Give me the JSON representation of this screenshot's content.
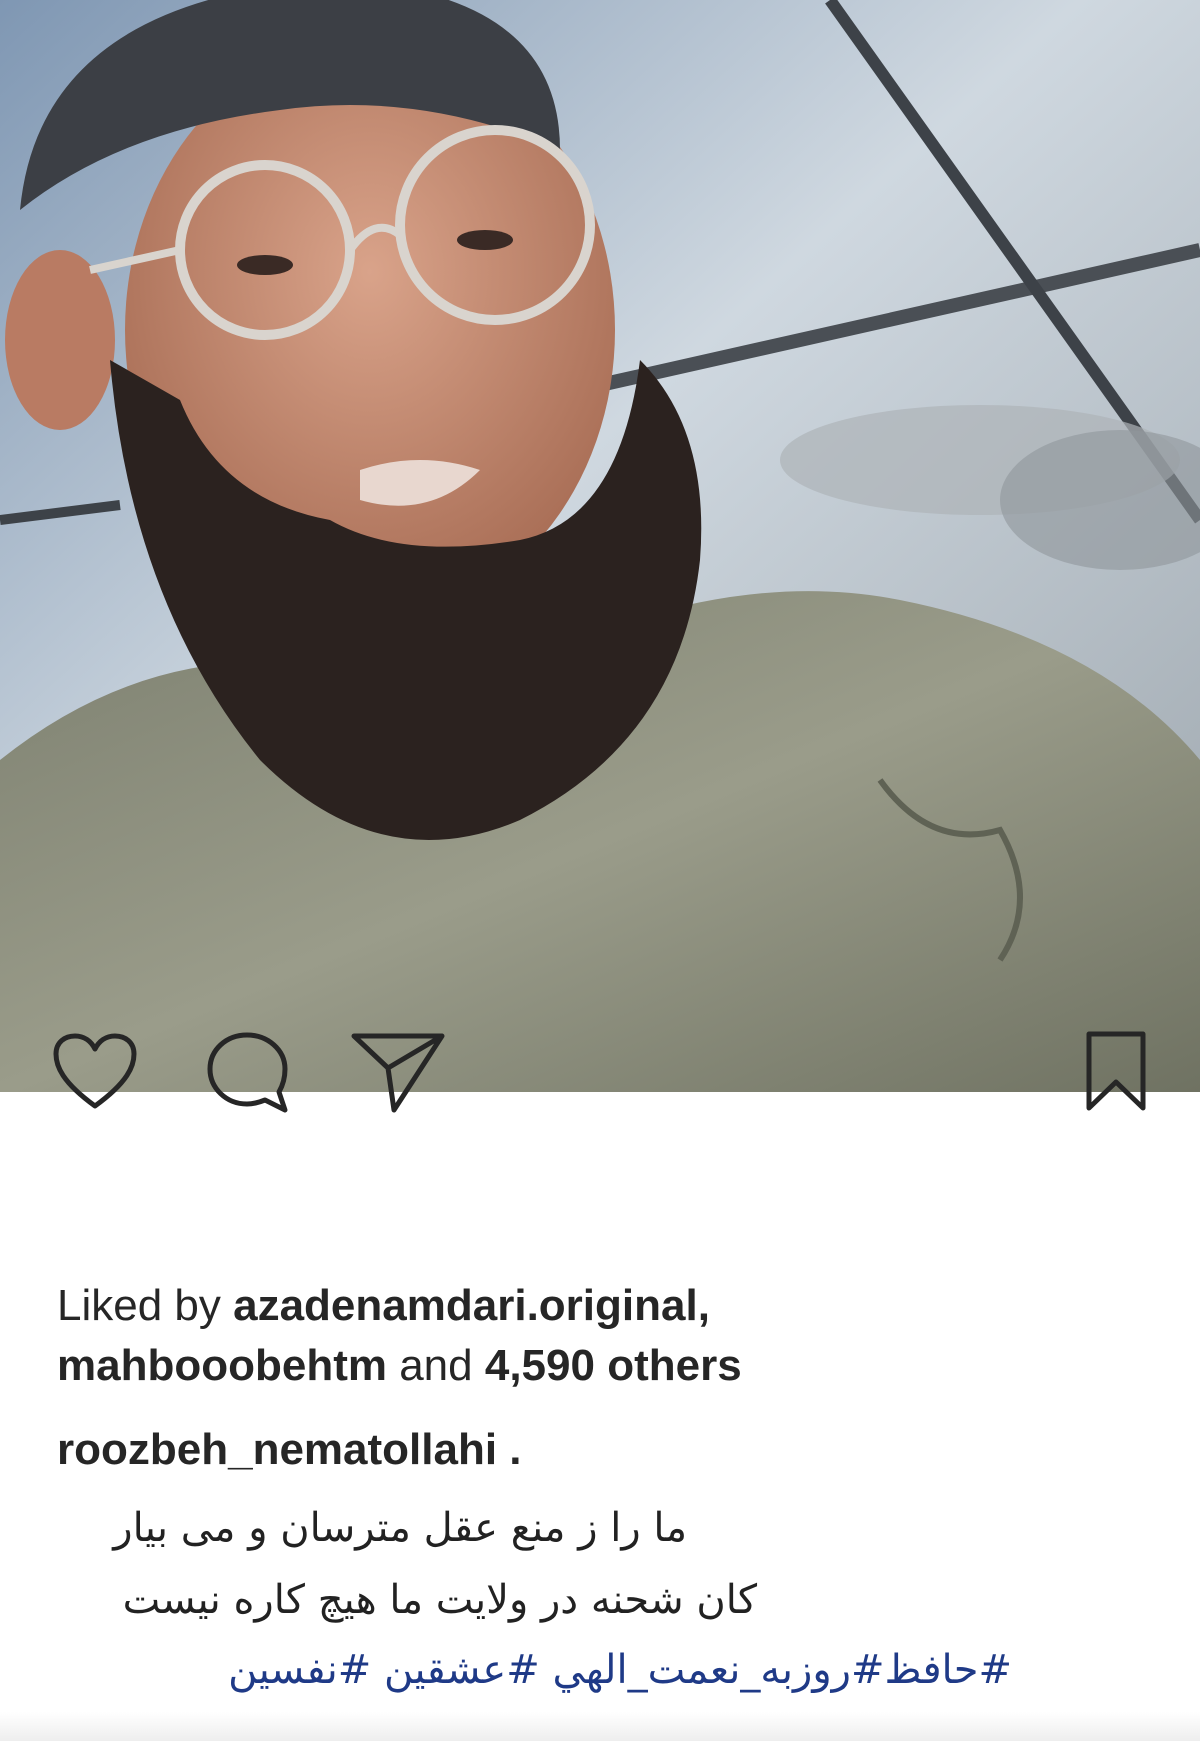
{
  "post": {
    "image_alt": "selfie photo",
    "actions": {
      "like_icon": "heart-icon",
      "comment_icon": "comment-icon",
      "share_icon": "paper-plane-icon",
      "save_icon": "bookmark-icon"
    },
    "likes": {
      "prefix": "Liked by ",
      "user1": "azadenamdari.original,",
      "user2": "mahbooobehtm",
      "middle": " and ",
      "others": "4,590 others"
    },
    "caption": {
      "username": "roozbeh_nematollahi",
      "suffix": " .",
      "line1": "ما را ز منع عقل مترسان و می بیار",
      "line2": "کان شحنه در ولایت ما هیچ کاره نیست"
    },
    "hashtags": [
      "#حافظ",
      "#روزبه_نعمت_الهي",
      "#عشقين",
      "#نفسين"
    ]
  }
}
